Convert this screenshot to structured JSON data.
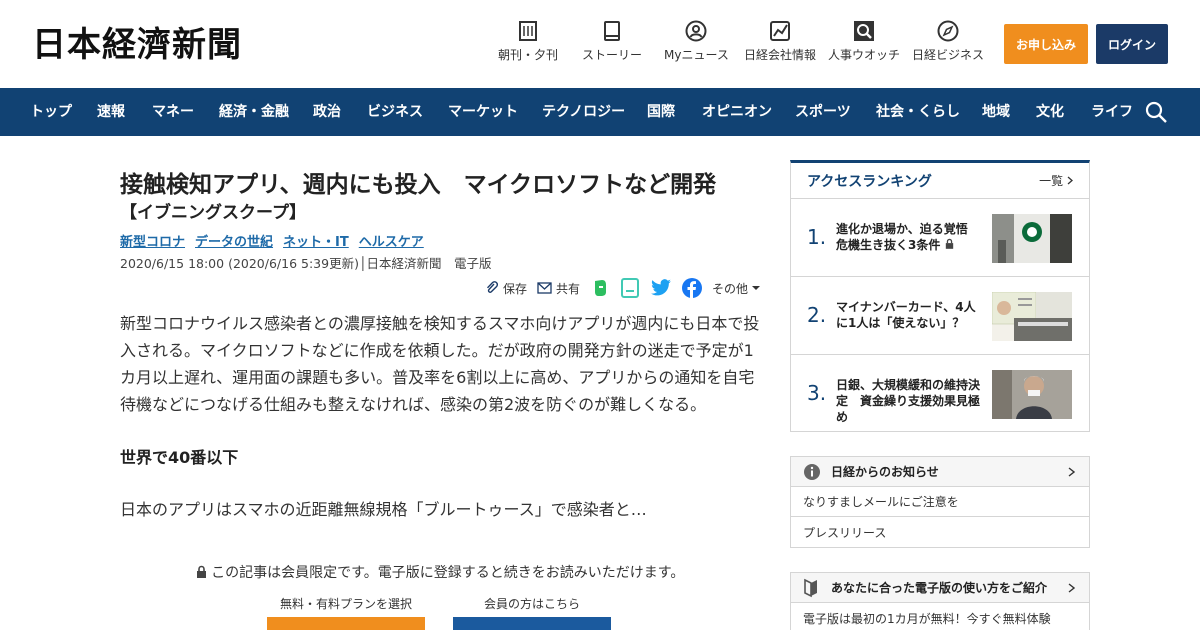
{
  "header": {
    "logo": "日本経濟新聞",
    "nav": [
      {
        "label": "朝刊・夕刊",
        "icon": "newspaper-icon"
      },
      {
        "label": "ストーリー",
        "icon": "story-icon"
      },
      {
        "label": "Myニュース",
        "icon": "user-icon"
      },
      {
        "label": "日経会社情報",
        "icon": "chart-icon"
      },
      {
        "label": "人事ウオッチ",
        "icon": "search-person-icon"
      },
      {
        "label": "日経ビジネス",
        "icon": "compass-icon"
      }
    ],
    "subscribe": "お申し込み",
    "login": "ログイン"
  },
  "navbar": {
    "items": [
      "トップ",
      "速報",
      "マネー",
      "経済・金融",
      "政治",
      "ビジネス",
      "マーケット",
      "テクノロジー",
      "国際",
      "オピニオン",
      "スポーツ",
      "社会・くらし",
      "地域",
      "文化",
      "ライフ"
    ]
  },
  "article": {
    "title": "接触検知アプリ、週内にも投入　マイクロソフトなど開発",
    "subtitle": "【イブニングスクープ】",
    "tags": [
      "新型コロナ",
      "データの世紀",
      "ネット・IT",
      "ヘルスケア"
    ],
    "meta": "2020/6/15 18:00 (2020/6/16 5:39更新)│日本経済新聞　電子版",
    "share": {
      "save": "保存",
      "share": "共有",
      "more": "その他"
    },
    "body": "新型コロナウイルス感染者との濃厚接触を検知するスマホ向けアプリが週内にも日本で投入される。マイクロソフトなどに作成を依頼した。だが政府の開発方針の迷走で予定が1カ月以上遅れ、運用面の課題も多い。普及率を6割以上に高め、アプリからの通知を自宅待機などにつなげる仕組みも整えなければ、感染の第2波を防ぐのが難しくなる。",
    "heading": "世界で40番以下",
    "teaser": "日本のアプリはスマホの近距離無線規格「ブルートゥース」で感染者と…",
    "paywall": "この記事は会員限定です。電子版に登録すると続きをお読みいただけます。",
    "plan_label": "無料・有料プランを選択",
    "member_label": "会員の方はこちら"
  },
  "ranking": {
    "title": "アクセスランキング",
    "more": "一覧",
    "items": [
      {
        "rank": "1.",
        "title": "進化か退場か、迫る覚悟　危機生き抜く3条件"
      },
      {
        "rank": "2.",
        "title": "マイナンバーカード、4人に1人は「使えない」？"
      },
      {
        "rank": "3.",
        "title": "日銀、大規模緩和の維持決定　資金繰り支援効果見極め"
      }
    ]
  },
  "notice": {
    "title": "日経からのお知らせ",
    "items": [
      "なりすましメールにご注意を",
      "プレスリリース"
    ]
  },
  "guide": {
    "title": "あなたに合った電子版の使い方をご紹介",
    "text": "電子版は最初の1カ月が無料！今すぐ無料体験"
  },
  "colors": {
    "navy": "#114273",
    "orange": "#f08e1e",
    "login": "#1b3a67",
    "link": "#1e6aa8"
  }
}
